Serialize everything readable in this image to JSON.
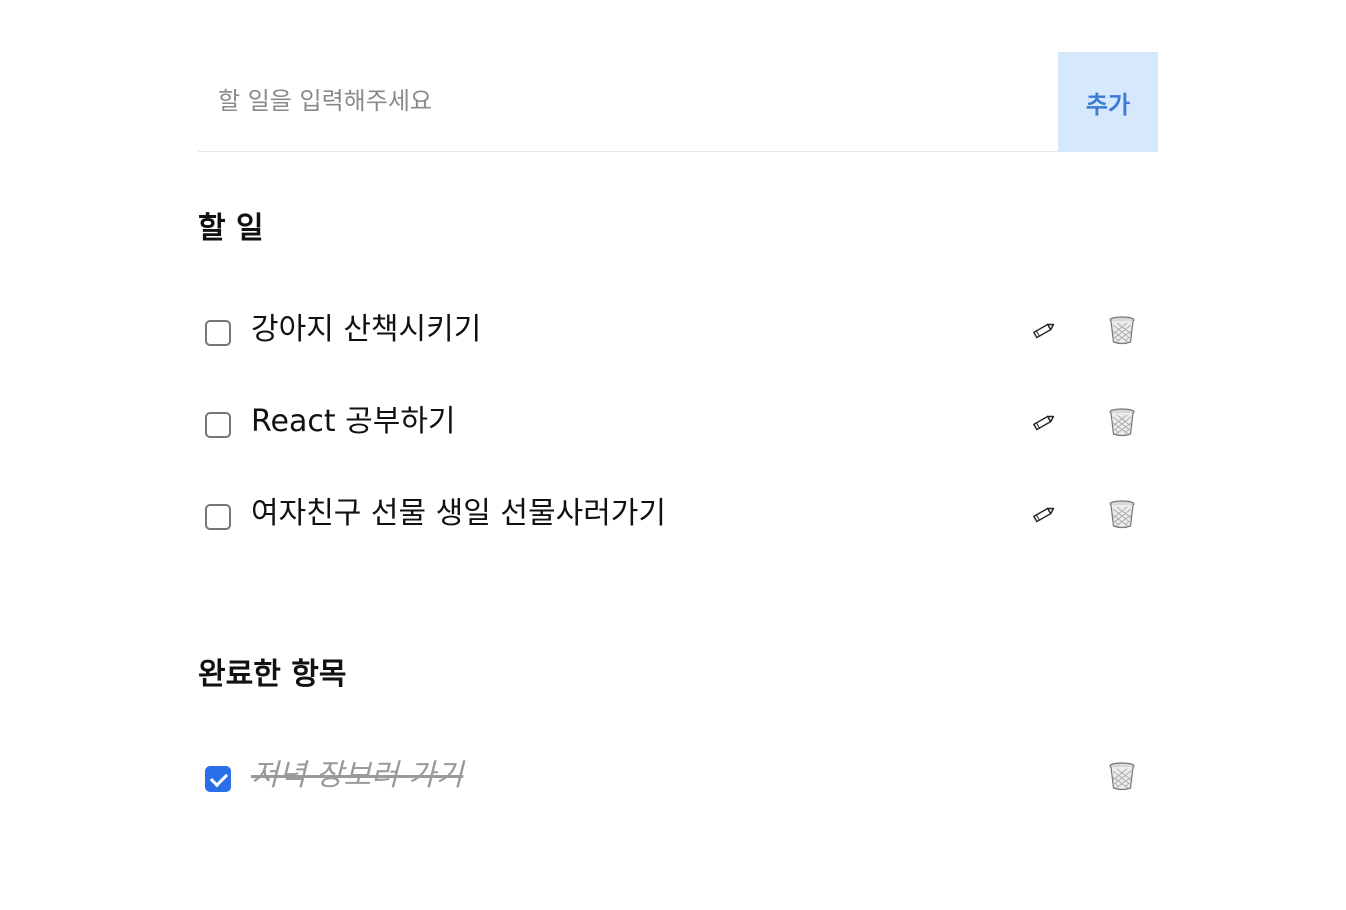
{
  "input": {
    "placeholder": "할 일을 입력해주세요",
    "value": ""
  },
  "add_button_label": "추가",
  "sections": {
    "todo": {
      "title": "할 일",
      "items": [
        {
          "text": "강아지 산책시키기",
          "checked": false,
          "edit_icon": "pencil-icon",
          "delete_icon": "trash-icon"
        },
        {
          "text": "React 공부하기",
          "checked": false,
          "edit_icon": "pencil-icon",
          "delete_icon": "trash-icon"
        },
        {
          "text": "여자친구 선물 생일 선물사러가기",
          "checked": false,
          "edit_icon": "pencil-icon",
          "delete_icon": "trash-icon"
        }
      ]
    },
    "done": {
      "title": "완료한 항목",
      "items": [
        {
          "text": "저녁 장보러 가기",
          "checked": true,
          "delete_icon": "trash-icon"
        }
      ]
    }
  },
  "colors": {
    "add_button_bg": "#d6e8fb",
    "add_button_text": "#3a7bd5",
    "checkbox_checked": "#2a6ee8",
    "done_text": "#9a9a9a"
  }
}
